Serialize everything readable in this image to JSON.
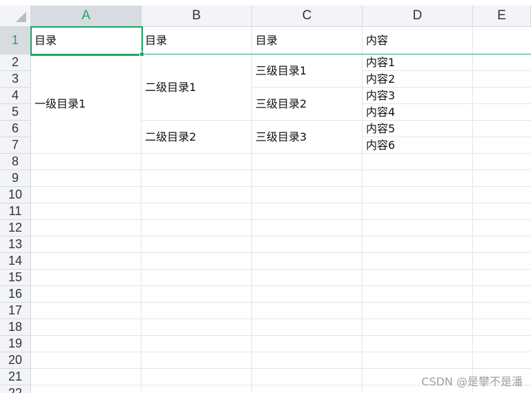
{
  "columns": [
    "A",
    "B",
    "C",
    "D",
    "E"
  ],
  "selected_column": "A",
  "rows": [
    "1",
    "2",
    "3",
    "4",
    "5",
    "6",
    "7",
    "8",
    "9",
    "10",
    "11",
    "12",
    "13",
    "14",
    "15",
    "16",
    "17",
    "18",
    "19",
    "20",
    "21",
    "22"
  ],
  "selected_row": "1",
  "cells": {
    "A1": "目录",
    "B1": "目录",
    "C1": "目录",
    "D1": "内容",
    "A2_7": "一级目录1",
    "B2_5": "二级目录1",
    "B6_7": "二级目录2",
    "C2_3": "三级目录1",
    "C4_5": "三级目录2",
    "C6_7": "三级目录3",
    "D2": "内容1",
    "D3": "内容2",
    "D4": "内容3",
    "D5": "内容4",
    "D6": "内容5",
    "D7": "内容6"
  },
  "watermark": "CSDN @是攀不是潘",
  "colors": {
    "selection": "#21a366",
    "header_bg": "#f3f4f7",
    "gridline": "#e3e5e8"
  }
}
